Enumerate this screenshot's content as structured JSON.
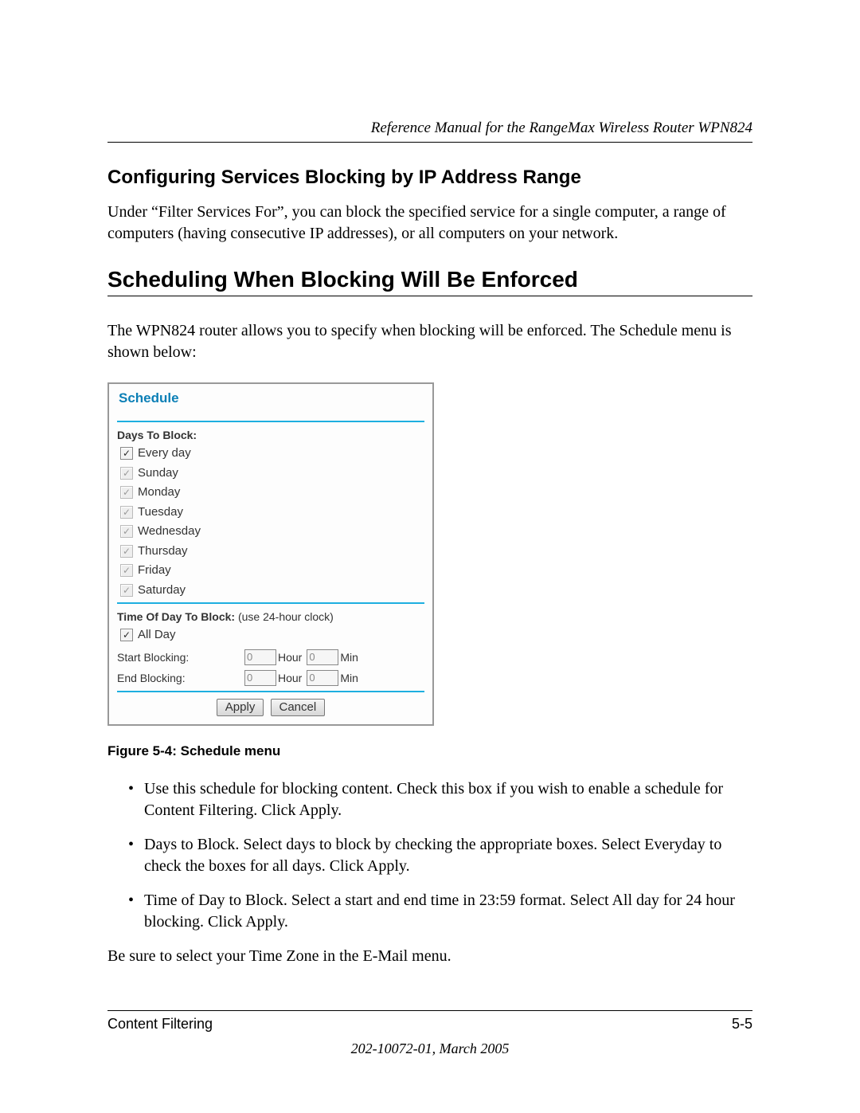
{
  "header": {
    "running_title": "Reference Manual for the RangeMax Wireless Router WPN824"
  },
  "section1": {
    "title": "Configuring Services Blocking by IP Address Range",
    "paragraph": "Under “Filter Services For”, you can block the specified service for a single computer, a range of computers (having consecutive IP addresses), or all computers on your network."
  },
  "section2": {
    "title": "Scheduling When Blocking Will Be Enforced",
    "paragraph": "The WPN824 router allows you to specify when blocking will be enforced. The Schedule menu is shown below:"
  },
  "figure": {
    "panel_title": "Schedule",
    "days_label": "Days To Block:",
    "days": {
      "everyday": "Every day",
      "sunday": "Sunday",
      "monday": "Monday",
      "tuesday": "Tuesday",
      "wednesday": "Wednesday",
      "thursday": "Thursday",
      "friday": "Friday",
      "saturday": "Saturday"
    },
    "time_label": "Time Of Day To Block:",
    "time_hint": " (use 24-hour clock)",
    "allday": "All Day",
    "start_label": "Start Blocking:",
    "end_label": "End Blocking:",
    "start_hour": "0",
    "start_min": "0",
    "end_hour": "0",
    "end_min": "0",
    "hour_unit": "Hour",
    "min_unit": "Min",
    "apply": "Apply",
    "cancel": "Cancel",
    "caption": "Figure 5-4:  Schedule menu"
  },
  "bullets": {
    "b1": "Use this schedule for blocking content. Check this box if you wish to enable a schedule for Content Filtering. Click Apply.",
    "b2": "Days to Block. Select days to block by checking the appropriate boxes. Select Everyday to check the boxes for all days. Click Apply.",
    "b3": "Time of Day to Block. Select a start and end time in 23:59 format. Select All day for 24 hour blocking. Click Apply."
  },
  "closing": "Be sure to select your Time Zone in the E-Mail menu.",
  "footer": {
    "left": "Content Filtering",
    "right": "5-5",
    "docid": "202-10072-01, March 2005"
  }
}
